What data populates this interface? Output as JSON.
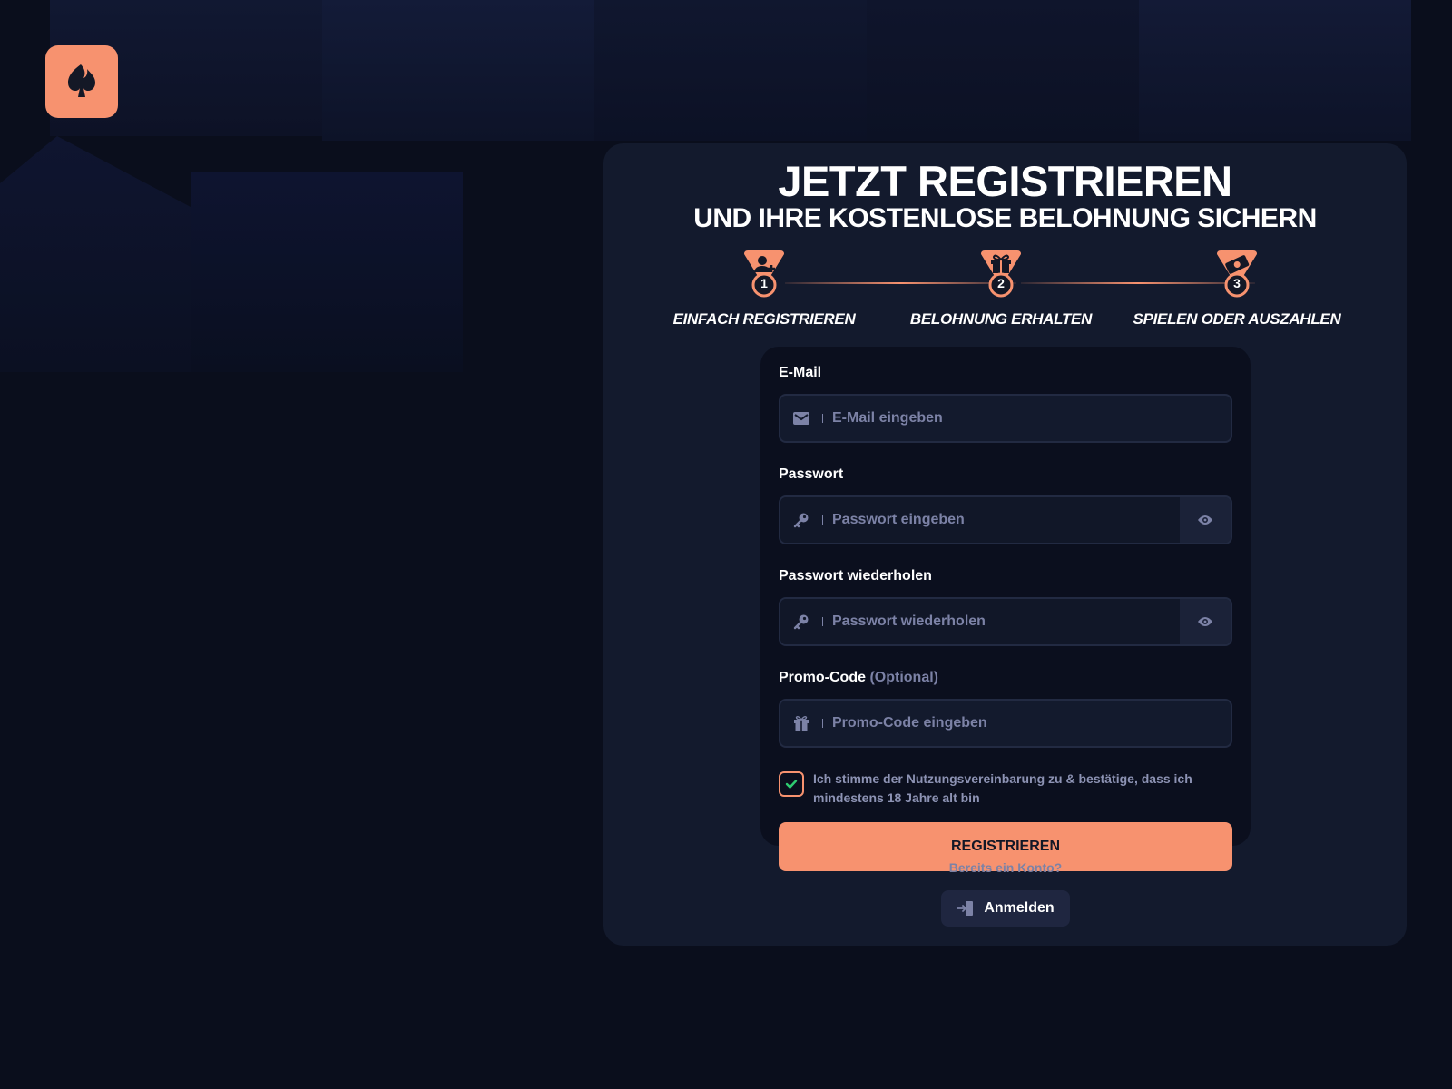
{
  "colors": {
    "accent": "#f7926f",
    "bg": "#0a0e1c",
    "panel": "#131a2d",
    "muted": "#7c82a6",
    "check": "#2ecc71"
  },
  "header": {
    "title": "JETZT REGISTRIEREN",
    "subtitle": "UND IHRE KOSTENLOSE BELOHNUNG SICHERN"
  },
  "steps": [
    {
      "number": "1",
      "label": "EINFACH REGISTRIEREN",
      "icon": "user-plus-icon"
    },
    {
      "number": "2",
      "label": "BELOHNUNG ERHALTEN",
      "icon": "gift-icon"
    },
    {
      "number": "3",
      "label": "SPIELEN ODER AUSZAHLEN",
      "icon": "cash-icon"
    }
  ],
  "form": {
    "email": {
      "label": "E-Mail",
      "placeholder": "E-Mail eingeben",
      "value": ""
    },
    "password": {
      "label": "Passwort",
      "placeholder": "Passwort eingeben",
      "value": ""
    },
    "password_repeat": {
      "label": "Passwort wiederholen",
      "placeholder": "Passwort wiederholen",
      "value": ""
    },
    "promo": {
      "label": "Promo-Code",
      "optional": "(Optional)",
      "placeholder": "Promo-Code eingeben",
      "value": ""
    },
    "agree_text": "Ich stimme der Nutzungsvereinbarung zu & bestätige, dass ich mindestens 18 Jahre alt bin",
    "agree_checked": true,
    "submit_label": "REGISTRIEREN"
  },
  "footer": {
    "divider_text": "Bereits ein Konto?",
    "login_label": "Anmelden"
  }
}
